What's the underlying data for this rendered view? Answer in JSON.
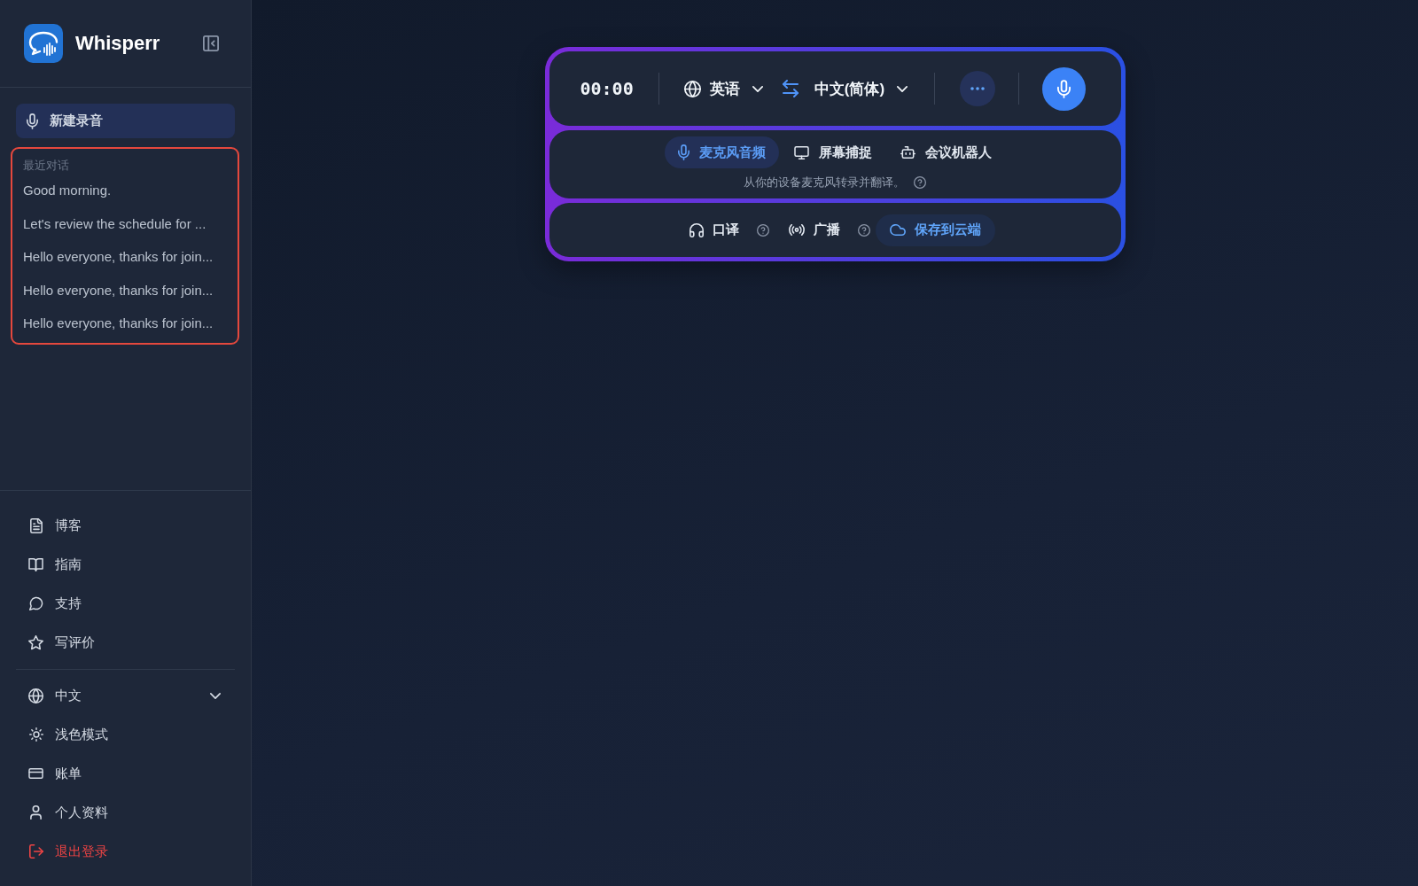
{
  "sidebar": {
    "app_name": "Whisperr",
    "new_recording": "新建录音",
    "recent": {
      "title": "最近对话",
      "highlighted": true,
      "items": [
        "Good morning.",
        "Let's review the schedule for ...",
        "Hello everyone, thanks for join...",
        "Hello everyone, thanks for join...",
        "Hello everyone, thanks for join..."
      ]
    },
    "links": [
      {
        "label": "博客",
        "kind": "blog"
      },
      {
        "label": "指南",
        "kind": "guide"
      },
      {
        "label": "支持",
        "kind": "support"
      },
      {
        "label": "写评价",
        "kind": "review"
      }
    ],
    "settings": [
      {
        "label": "中文",
        "kind": "language"
      },
      {
        "label": "浅色模式",
        "kind": "theme"
      },
      {
        "label": "账单",
        "kind": "billing"
      },
      {
        "label": "个人资料",
        "kind": "profile"
      },
      {
        "label": "退出登录",
        "kind": "logout"
      }
    ]
  },
  "recorder": {
    "timer": "00:00",
    "source_language": "英语",
    "target_language": "中文(简体)",
    "sources": [
      {
        "label": "麦克风音频",
        "kind": "microphone",
        "selected": true
      },
      {
        "label": "屏幕捕捉",
        "kind": "screen",
        "selected": false
      },
      {
        "label": "会议机器人",
        "kind": "bot",
        "selected": false
      }
    ],
    "source_hint": "从你的设备麦克风转录并翻译。",
    "options": [
      {
        "label": "口译",
        "kind": "interpret",
        "selected": false,
        "help": true
      },
      {
        "label": "广播",
        "kind": "broadcast",
        "selected": false,
        "help": true
      },
      {
        "label": "保存到云端",
        "kind": "cloud",
        "selected": true,
        "help": false
      }
    ]
  }
}
